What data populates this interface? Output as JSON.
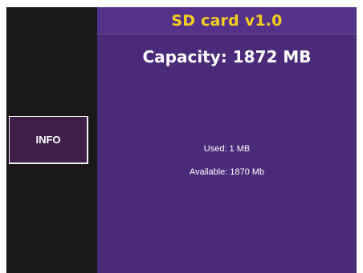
{
  "sidebar": {
    "info_label": "INFO"
  },
  "main": {
    "title": "SD card v1.0",
    "capacity": "Capacity: 1872 MB",
    "used": "Used: 1 MB",
    "available": "Available: 1870 Mb"
  },
  "colors": {
    "background": "#ffffff",
    "sidebar": "#1a1818",
    "button": "#40204a",
    "panel": "#4b2a7a",
    "header": "#55328a",
    "title": "#f5cf1e",
    "text": "#ffffff"
  }
}
